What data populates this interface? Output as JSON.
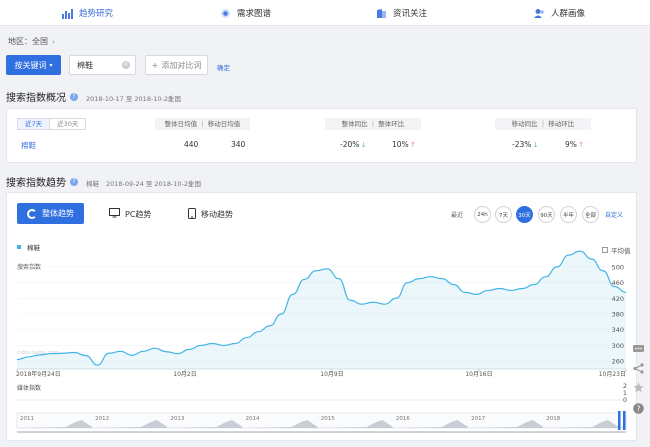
{
  "nav": {
    "items": [
      {
        "label": "趋势研究",
        "icon": "trend-chart-icon"
      },
      {
        "label": "需求图谱",
        "icon": "demand-map-icon"
      },
      {
        "label": "资讯关注",
        "icon": "news-icon"
      },
      {
        "label": "人群画像",
        "icon": "crowd-portrait-icon"
      }
    ]
  },
  "breadcrumb": {
    "label": "地区：全国"
  },
  "search": {
    "mode_label": "按关键词",
    "keyword": "棉鞋",
    "add_compare": "添加对比词",
    "confirm": "确定"
  },
  "overview": {
    "title": "搜索指数概况",
    "date_range": "2018-10-17 至 2018-10-23",
    "region": "全国",
    "tabs": [
      "近7天",
      "近30天"
    ],
    "headers": {
      "avg": "整体日均值 ｜ 移动日均值",
      "overall": "整体同比 ｜ 整体环比",
      "mobile": "移动同比 ｜ 移动环比"
    },
    "row": {
      "keyword": "棉鞋",
      "overall_avg": "440",
      "mobile_avg": "340",
      "overall_yoy": "-20%",
      "overall_mom": "10%",
      "mobile_yoy": "-23%",
      "mobile_mom": "9%"
    }
  },
  "trend": {
    "title": "搜索指数趋势",
    "keyword": "棉鞋",
    "date_range": "2018-09-24 至 2018-10-23",
    "region": "全国",
    "tabs": {
      "overall": "整体趋势",
      "pc": "PC趋势",
      "mobile": "移动趋势"
    },
    "range_label": "最近",
    "ranges": [
      "24h",
      "7天",
      "30天",
      "90天",
      "半年",
      "全部"
    ],
    "custom": "自定义",
    "avg_toggle": "平均值",
    "ylabel": "搜索指数",
    "media_label": "媒体指数",
    "watermark": "index.baidu.com"
  },
  "chart_data": {
    "type": "area",
    "series": [
      {
        "name": "棉鞋",
        "color": "#42b4e6",
        "values": [
          264,
          271,
          276,
          279,
          280,
          282,
          274,
          250,
          280,
          285,
          275,
          285,
          293,
          284,
          279,
          290,
          300,
          305,
          300,
          305,
          320,
          335,
          350,
          380,
          430,
          468,
          490,
          495,
          470,
          415,
          405,
          410,
          405,
          420,
          460,
          470,
          475,
          470,
          455,
          435,
          430,
          440,
          445,
          440,
          445,
          455,
          475,
          500,
          530,
          540,
          520,
          490,
          450,
          435
        ]
      }
    ],
    "x_ticks": [
      "2018年9月24日",
      "10月2日",
      "10月9日",
      "10月16日",
      "10月23日"
    ],
    "y_ticks": [
      260,
      300,
      340,
      380,
      420,
      460,
      500
    ],
    "ylim": [
      240,
      520
    ],
    "media_ticks": [
      "2",
      "1",
      "0"
    ],
    "navigator_years": [
      "2011",
      "2012",
      "2013",
      "2014",
      "2015",
      "2016",
      "2017",
      "2018"
    ]
  }
}
